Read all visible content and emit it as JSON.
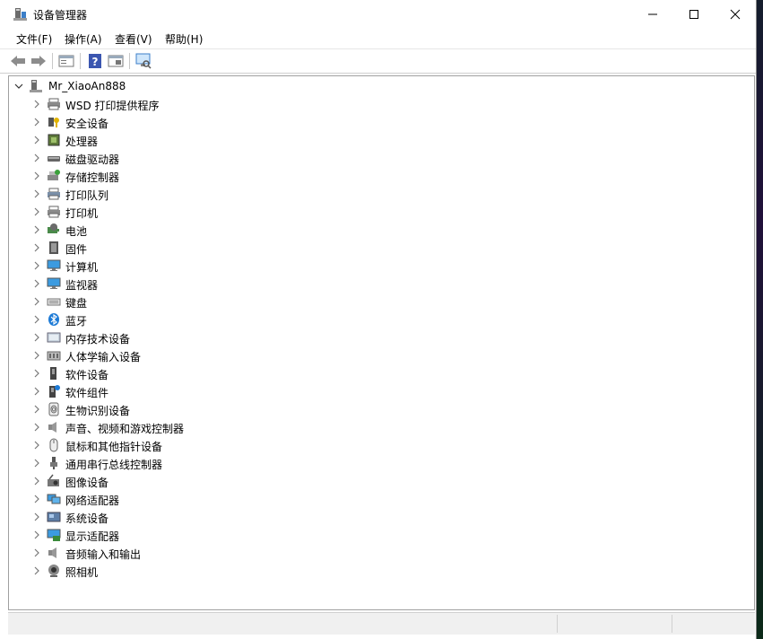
{
  "window": {
    "title": "设备管理器",
    "controls": {
      "minimize": "minimize",
      "maximize": "maximize",
      "close": "close"
    }
  },
  "menu": [
    {
      "label": "文件(F)"
    },
    {
      "label": "操作(A)"
    },
    {
      "label": "查看(V)"
    },
    {
      "label": "帮助(H)"
    }
  ],
  "toolbar": {
    "buttons": [
      "back-arrow-icon",
      "forward-arrow-icon",
      "properties-icon",
      "help-icon",
      "update-driver-icon",
      "scan-hardware-icon"
    ]
  },
  "tree": {
    "root": {
      "label": "Mr_XiaoAn888",
      "icon": "computer-tower-icon",
      "expanded": true
    },
    "categories": [
      {
        "label": "WSD 打印提供程序",
        "icon": "printer-icon"
      },
      {
        "label": "安全设备",
        "icon": "security-key-icon"
      },
      {
        "label": "处理器",
        "icon": "processor-icon"
      },
      {
        "label": "磁盘驱动器",
        "icon": "disk-drive-icon"
      },
      {
        "label": "存储控制器",
        "icon": "storage-controller-icon"
      },
      {
        "label": "打印队列",
        "icon": "print-queue-icon"
      },
      {
        "label": "打印机",
        "icon": "printer-icon"
      },
      {
        "label": "电池",
        "icon": "battery-icon"
      },
      {
        "label": "固件",
        "icon": "firmware-icon"
      },
      {
        "label": "计算机",
        "icon": "computer-icon"
      },
      {
        "label": "监视器",
        "icon": "monitor-icon"
      },
      {
        "label": "键盘",
        "icon": "keyboard-icon"
      },
      {
        "label": "蓝牙",
        "icon": "bluetooth-icon"
      },
      {
        "label": "内存技术设备",
        "icon": "memory-icon"
      },
      {
        "label": "人体学输入设备",
        "icon": "hid-icon"
      },
      {
        "label": "软件设备",
        "icon": "software-device-icon"
      },
      {
        "label": "软件组件",
        "icon": "software-component-icon"
      },
      {
        "label": "生物识别设备",
        "icon": "fingerprint-icon"
      },
      {
        "label": "声音、视频和游戏控制器",
        "icon": "speaker-icon"
      },
      {
        "label": "鼠标和其他指针设备",
        "icon": "mouse-icon"
      },
      {
        "label": "通用串行总线控制器",
        "icon": "usb-icon"
      },
      {
        "label": "图像设备",
        "icon": "imaging-device-icon"
      },
      {
        "label": "网络适配器",
        "icon": "network-adapter-icon"
      },
      {
        "label": "系统设备",
        "icon": "system-device-icon"
      },
      {
        "label": "显示适配器",
        "icon": "display-adapter-icon"
      },
      {
        "label": "音频输入和输出",
        "icon": "audio-io-icon"
      },
      {
        "label": "照相机",
        "icon": "camera-icon"
      }
    ]
  },
  "colors": {
    "accent_blue": "#1e7bd6",
    "monitor_blue": "#3c9be0",
    "gray_icon": "#6b6b6b"
  }
}
